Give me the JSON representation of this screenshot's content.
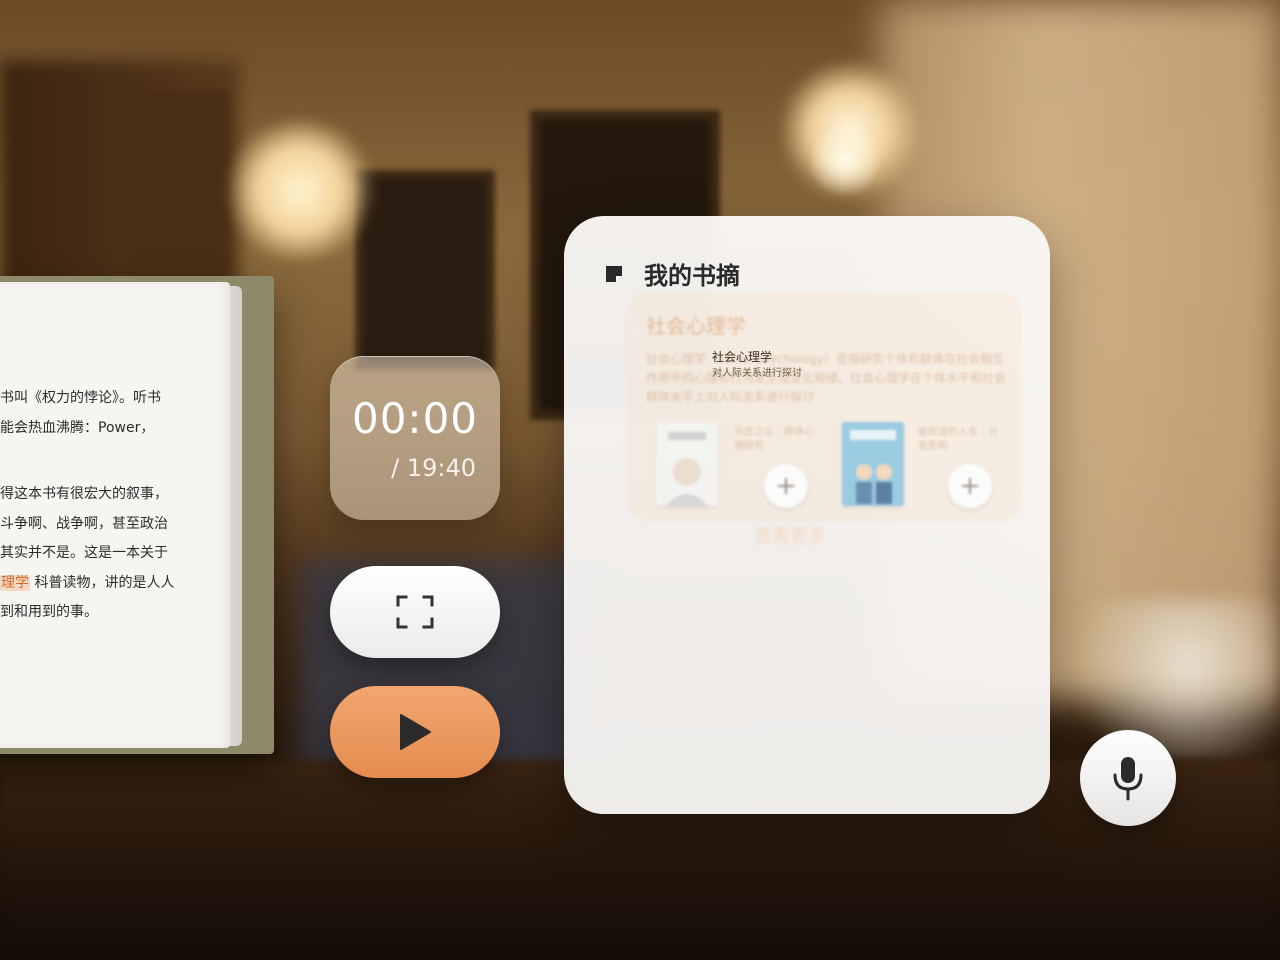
{
  "book": {
    "lines": [
      "书叫《权力的悖论》。听书",
      "能会热血沸腾：Power，",
      "得这本书有很宏大的叙事，",
      "斗争啊、战争啊，甚至政治",
      "其实并不是。这是一本关于",
      "科普读物，讲的是人人",
      "到和用到的事。"
    ],
    "highlight": "理学"
  },
  "player": {
    "elapsed": "00:00",
    "total": "/ 19:40",
    "fullscreen_icon": "fullscreen-icon",
    "play_icon": "play-icon",
    "play_color": "#e98f54"
  },
  "notes": {
    "title": "我的书摘",
    "title_icon": "note-icon",
    "card": {
      "title": "社会心理学",
      "description": "社会心理学（social psychology）是指研究个体和群体在社会相互作用中的心理和行为发生及变化规律。社会心理学在个体水平和社会群体水平上对人际关系进行探讨",
      "popup_title": "社会心理学",
      "popup_sub": "对人际关系进行探讨",
      "books": [
        {
          "caption": "乌合之众｜群体心理研究"
        },
        {
          "caption": "被知道的人生｜社会影响"
        }
      ],
      "add_icon": "plus-icon"
    },
    "more_hint": "查看更多"
  },
  "mic": {
    "icon": "microphone-icon"
  },
  "colors": {
    "accent": "#e98f54",
    "panel": "#f7f5f3",
    "text": "#2a2a2a"
  }
}
